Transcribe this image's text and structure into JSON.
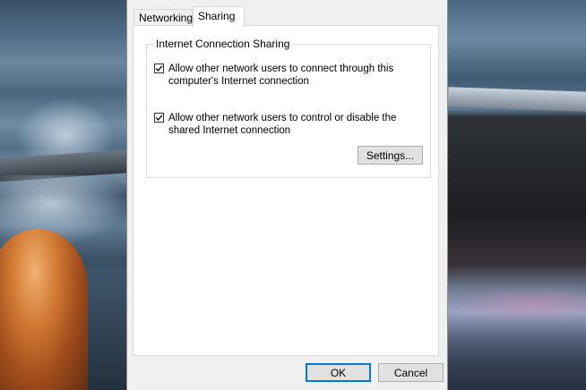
{
  "dialog": {
    "tabs": [
      {
        "label": "Networking",
        "active": false
      },
      {
        "label": "Sharing",
        "active": true
      }
    ],
    "group": {
      "title": "Internet Connection Sharing",
      "options": [
        {
          "label": "Allow other network users to connect through this computer's Internet connection",
          "checked": true
        },
        {
          "label": "Allow other network users to control or disable the shared Internet connection",
          "checked": true
        }
      ],
      "settings_label": "Settings..."
    },
    "ok_label": "OK",
    "cancel_label": "Cancel"
  },
  "colors": {
    "dialog_bg": "#f0f0f0",
    "panel_bg": "#ffffff",
    "button_bg": "#e1e1e1",
    "default_button_border": "#0078d7"
  }
}
